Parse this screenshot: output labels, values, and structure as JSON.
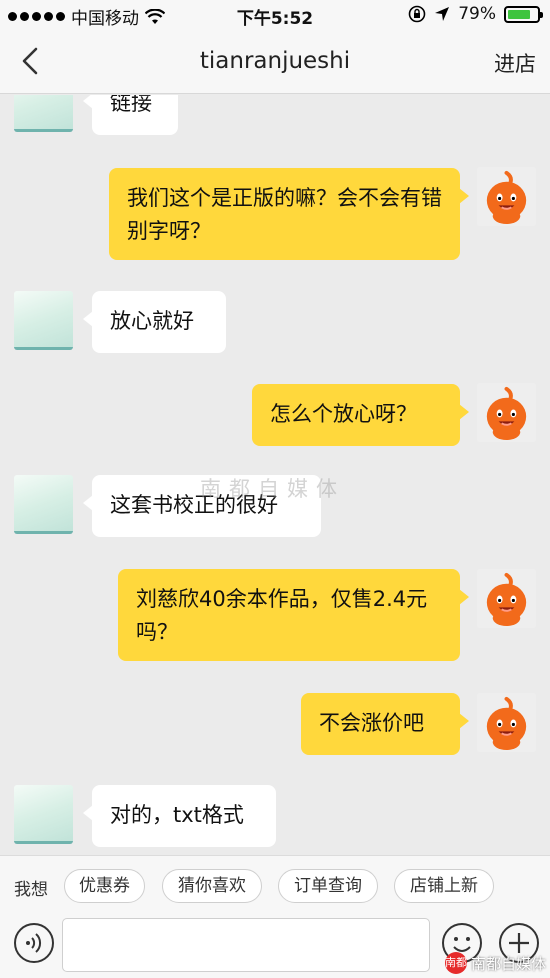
{
  "status_bar": {
    "carrier": "中国移动",
    "time": "下午5:52",
    "battery": "79%",
    "battery_level": 0.79
  },
  "nav": {
    "title": "tianranjueshi",
    "shop_label": "进店"
  },
  "messages": [
    {
      "side": "left",
      "text": "链接"
    },
    {
      "side": "right",
      "text": "我们这个是正版的嘛？会不会有错别字呀？"
    },
    {
      "side": "left",
      "text": "放心就好"
    },
    {
      "side": "right",
      "text": "怎么个放心呀？"
    },
    {
      "side": "left",
      "text": "这套书校正的很好"
    },
    {
      "side": "right",
      "text": "刘慈欣40余本作品，仅售2.4元吗？"
    },
    {
      "side": "right",
      "text": "不会涨价吧"
    },
    {
      "side": "left",
      "text": "对的，txt格式"
    }
  ],
  "watermark": "南都自媒体",
  "quick_replies": {
    "label": "我想",
    "chips": [
      "优惠券",
      "猜你喜欢",
      "订单查询",
      "店铺上新"
    ]
  },
  "input": {
    "placeholder": "",
    "voice_icon": "voice-icon",
    "emoji_icon": "emoji-icon",
    "plus_icon": "plus-icon"
  },
  "brand_watermark": {
    "logo_text": "南都",
    "text": "南都自媒体"
  },
  "colors": {
    "my_bubble": "#ffd83c",
    "their_bubble": "#ffffff",
    "background": "#ebebeb",
    "mascot": "#f26a1b"
  }
}
